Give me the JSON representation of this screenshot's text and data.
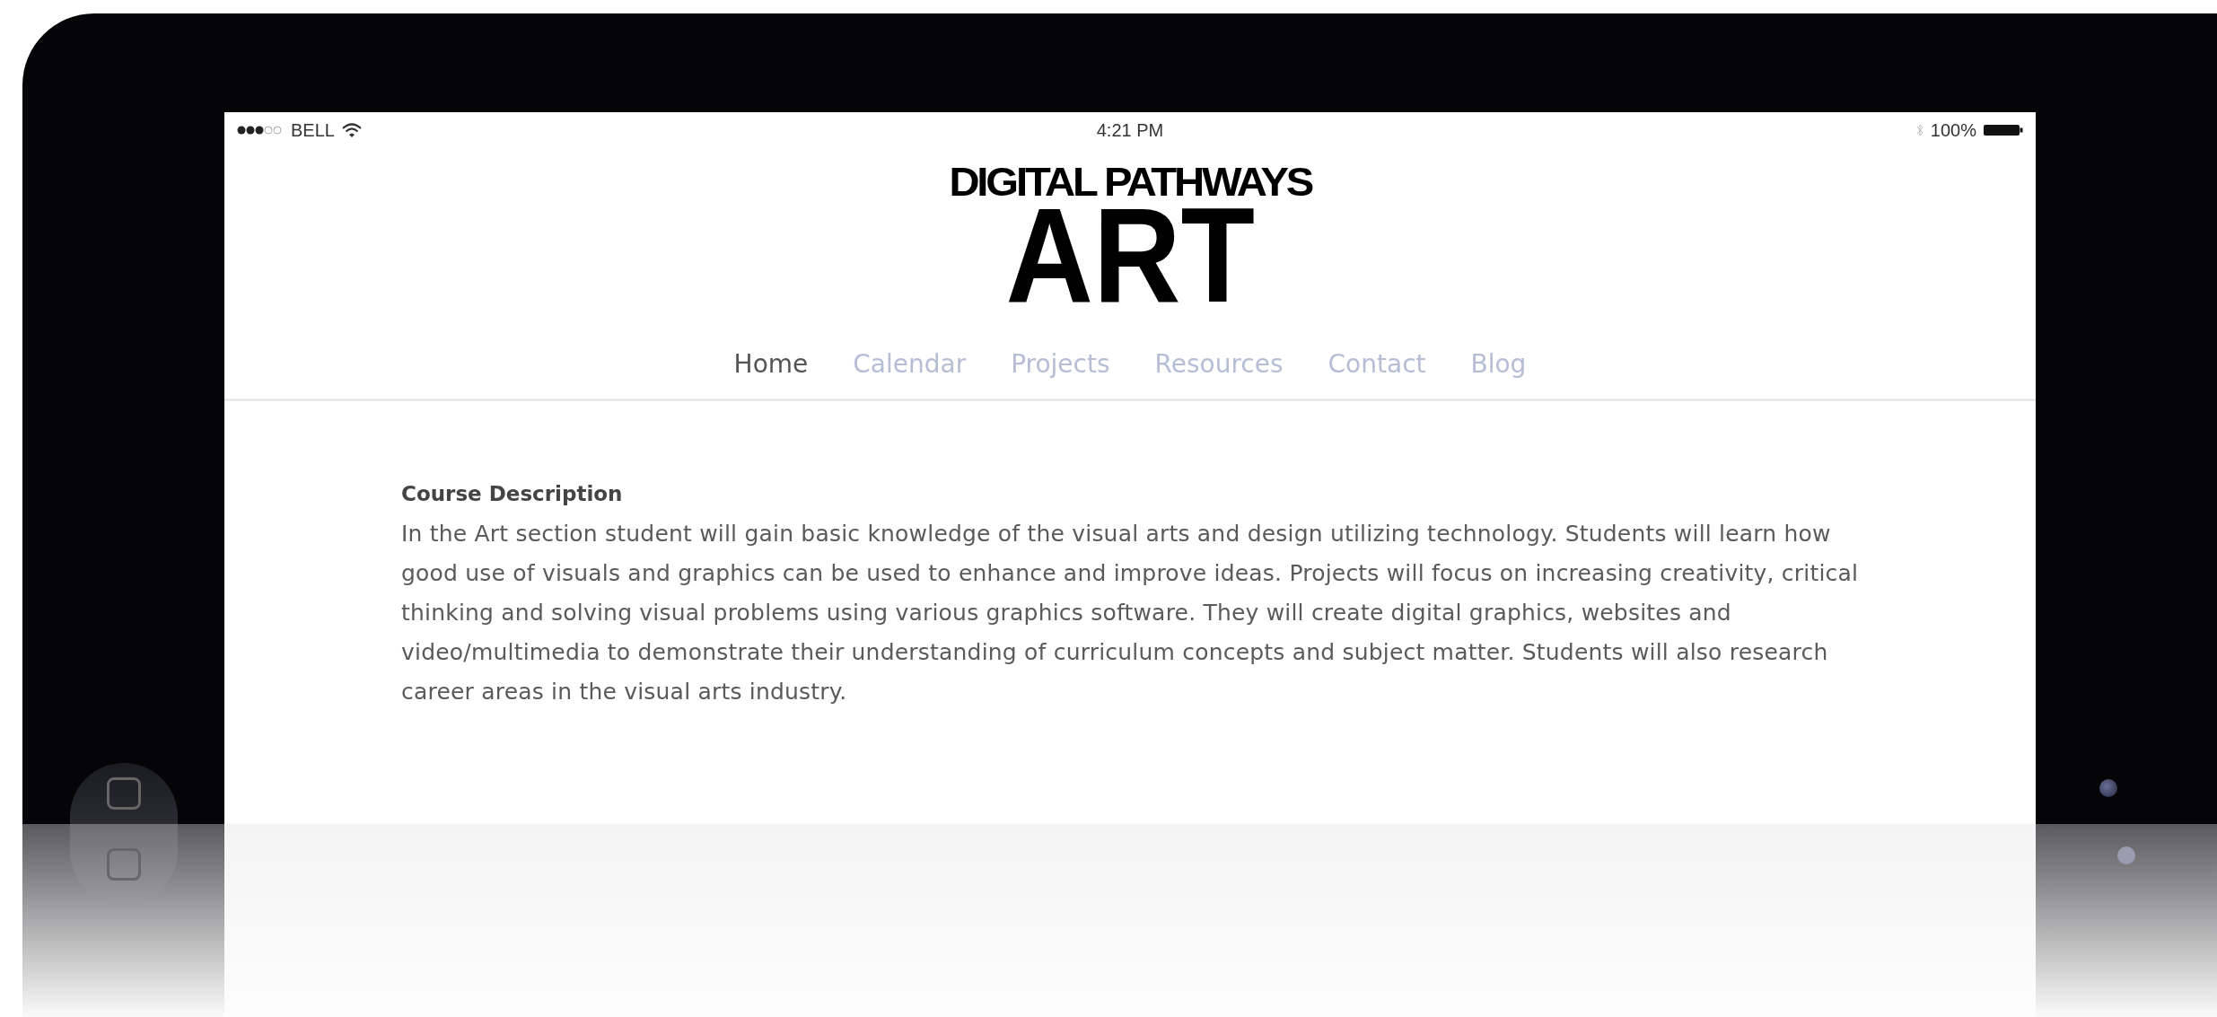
{
  "status_bar": {
    "carrier": "BELL",
    "time": "4:21 PM",
    "battery": "100%"
  },
  "logo": {
    "line_1": "DIGITAL PATHWAYS",
    "line_2": "ART"
  },
  "nav": [
    {
      "label": "Home",
      "selected": true
    },
    {
      "label": "Calendar",
      "selected": false
    },
    {
      "label": "Projects",
      "selected": false
    },
    {
      "label": "Resources",
      "selected": false
    },
    {
      "label": "Contact",
      "selected": false
    },
    {
      "label": "Blog",
      "selected": false
    }
  ],
  "content": {
    "heading": "Course Description",
    "paragraph": "In the Art section student will gain basic knowledge of the visual arts and design utilizing technology. Students will learn how good use of visuals and graphics can be used to enhance and improve ideas. Projects will focus on increasing creativity, critical thinking and solving visual problems using various graphics software. They will create digital graphics, websites and video/multimedia to demonstrate their understanding of curriculum concepts and subject matter. Students will also research career areas in the visual arts industry."
  }
}
